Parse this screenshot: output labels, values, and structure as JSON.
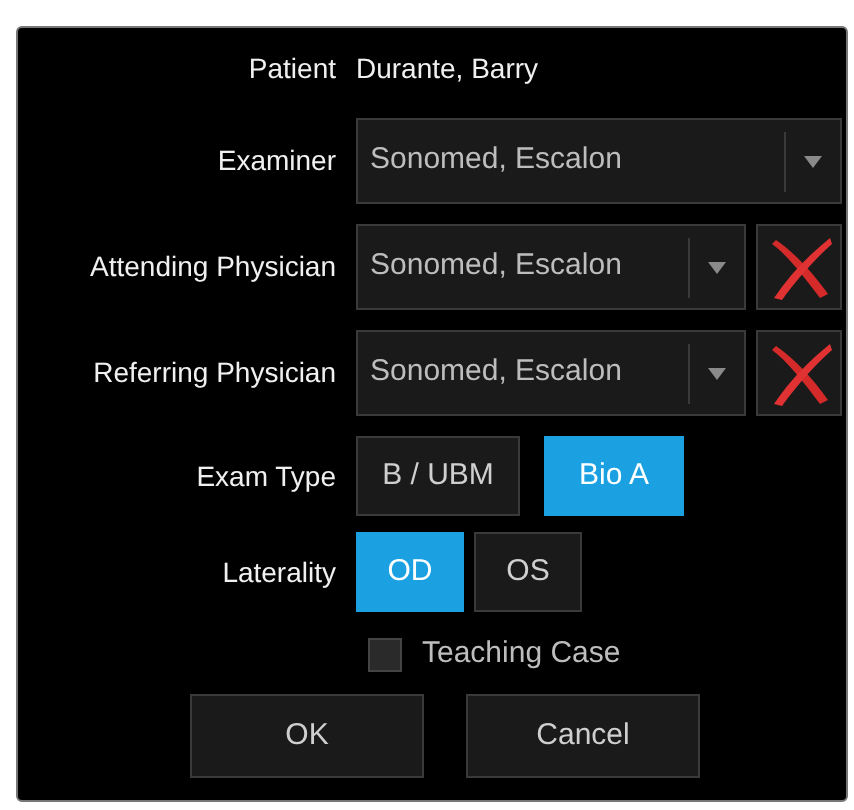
{
  "patient": {
    "label": "Patient",
    "value": "Durante, Barry"
  },
  "dropdowns": [
    {
      "label": "Examiner",
      "value": "Sonomed, Escalon",
      "clearable": false
    },
    {
      "label": "Attending Physician",
      "value": "Sonomed, Escalon",
      "clearable": true
    },
    {
      "label": "Referring Physician",
      "value": "Sonomed, Escalon",
      "clearable": true
    }
  ],
  "exam_type": {
    "label": "Exam Type",
    "options": [
      {
        "label": "B / UBM",
        "selected": false
      },
      {
        "label": "Bio A",
        "selected": true
      }
    ]
  },
  "laterality": {
    "label": "Laterality",
    "options": [
      {
        "label": "OD",
        "selected": true
      },
      {
        "label": "OS",
        "selected": false
      }
    ]
  },
  "teaching_case": {
    "label": "Teaching Case",
    "checked": false
  },
  "buttons": [
    "OK",
    "Cancel"
  ]
}
